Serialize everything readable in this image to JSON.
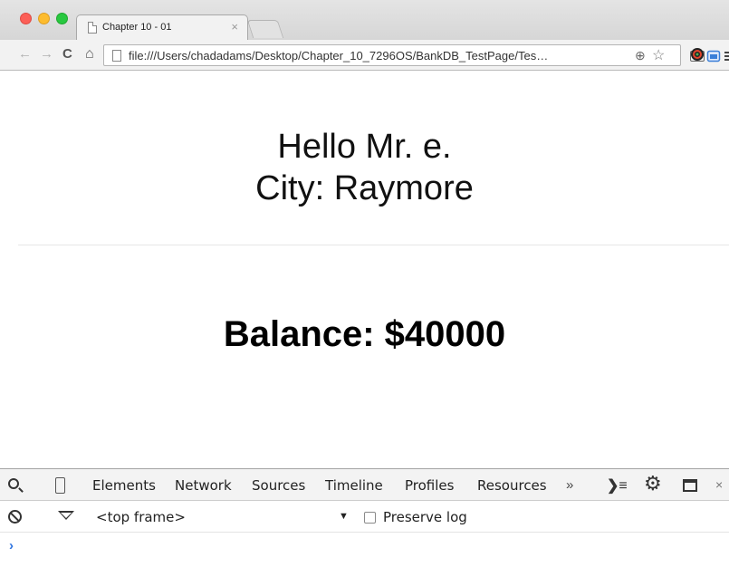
{
  "browser": {
    "tab_title": "Chapter 10 - 01",
    "tab_close": "×",
    "url": "file:///Users/chadadams/Desktop/Chapter_10_7296OS/BankDB_TestPage/Tes…"
  },
  "icons": {
    "back": "back-arrow-icon",
    "forward": "forward-arrow-icon",
    "reload": "reload-icon",
    "home": "home-icon",
    "zoom": "zoom-icon",
    "bookmark": "star-icon",
    "cast": "cast-icon",
    "screen": "screen-capture-icon",
    "extension": "extension-icon",
    "menu": "menu-icon"
  },
  "page": {
    "greeting_line1": "Hello Mr. e.",
    "greeting_line2": "City: Raymore",
    "balance": "Balance: $40000"
  },
  "devtools": {
    "tabs": [
      "Elements",
      "Network",
      "Sources",
      "Timeline",
      "Profiles",
      "Resources"
    ],
    "more": "»",
    "close": "×",
    "context": "<top frame>",
    "preserve_log": "Preserve log",
    "preserve_log_checked": false,
    "prompt": "›"
  }
}
